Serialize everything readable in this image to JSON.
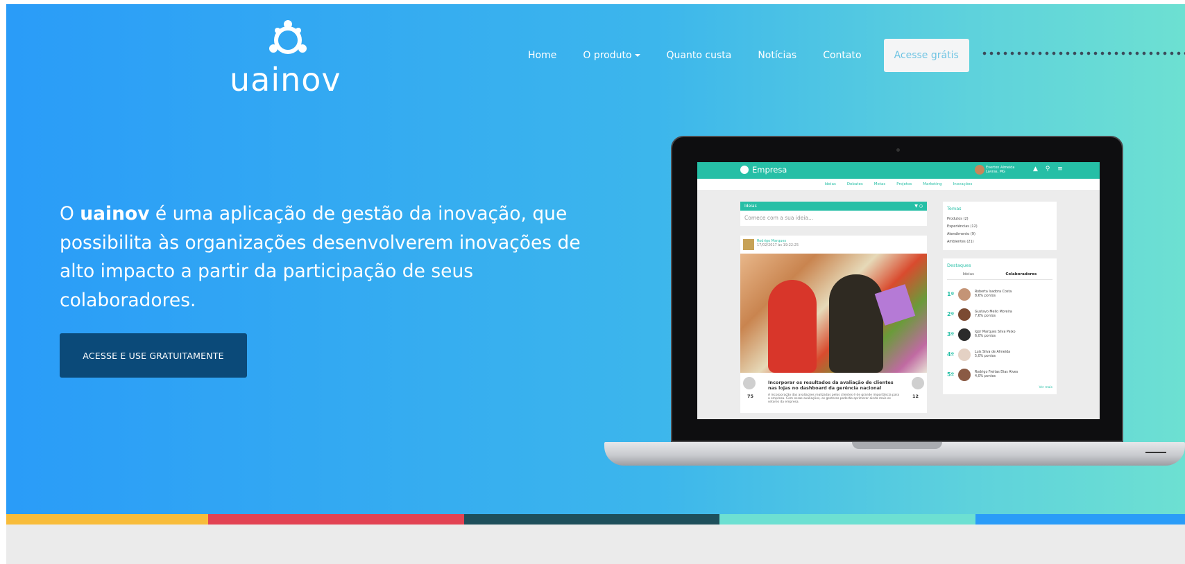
{
  "logo": {
    "text": "uainov",
    "icon": "people-circle-logo-icon"
  },
  "nav": {
    "items": [
      {
        "label": "Home"
      },
      {
        "label": "O produto",
        "dropdown": true
      },
      {
        "label": "Quanto custa"
      },
      {
        "label": "Notícias"
      },
      {
        "label": "Contato"
      }
    ],
    "cta": "Acesse grátis"
  },
  "hero": {
    "text_before": "O ",
    "brand": "uainov",
    "text_after": " é uma aplicação de gestão da inovação, que possibilita às organizações desenvolverem inovações de alto impacto a partir da participação de seus colaboradores.",
    "button": "ACESSE E USE GRATUITAMENTE"
  },
  "mockup": {
    "brand": "Empresa",
    "user": [
      "Everton Almeida",
      "Lavras, MG"
    ],
    "icons": "▲ ⚲ ≡",
    "tabs": [
      "Ideias",
      "Debates",
      "Metas",
      "Projetos",
      "Marketing",
      "Inovações"
    ],
    "ideas_header": "Ideias",
    "ideas_header_icons": "▼ ◷",
    "idea_placeholder": "Comece com a sua ideia...",
    "post": {
      "author": "Rodrigo Marques",
      "date": "17/02/2017 às 19:22:25",
      "title": "Incorporar os resultados da avaliação de clientes nas lojas no dashboard da gerência nacional",
      "text": "A incorporação das avaliações realizadas pelos clientes é de grande importância para a empresa. Com essas avaliações, os gestores poderão aprimorar ainda mais os setores da empresa.",
      "likes": "75",
      "dislikes": "12"
    },
    "temas": {
      "title": "Temas",
      "items": [
        "Produtos (2)",
        "Experiências (12)",
        "Atendimento (9)",
        "Ambientes (21)"
      ]
    },
    "destaques": {
      "title": "Destaques",
      "tabs": [
        "Ideias",
        "Colaboradores"
      ],
      "ranking": [
        {
          "pos": "1º",
          "name": "Roberta Isadora Costa",
          "points": "8,6% pontos"
        },
        {
          "pos": "2º",
          "name": "Gustavo Mello Moreira",
          "points": "7,6% pontos"
        },
        {
          "pos": "3º",
          "name": "Igor Marques Silva Peixo",
          "points": "6,0% pontos"
        },
        {
          "pos": "4º",
          "name": "Luis Silva de Almeida",
          "points": "5,0% pontos"
        },
        {
          "pos": "5º",
          "name": "Rodrigo Freitas Dias Alves",
          "points": "4,0% pontos"
        }
      ],
      "see_more": "Ver mais"
    }
  },
  "stripes": {
    "colors": [
      "#f8bc3a",
      "#e24353",
      "#1e4f5b",
      "#6de0d2",
      "#2a9cf8"
    ]
  },
  "colors": {
    "hero_start": "#2a9cf8",
    "hero_end": "#6de0d2",
    "button": "#0b4a79",
    "accent": "#26bfa6"
  }
}
